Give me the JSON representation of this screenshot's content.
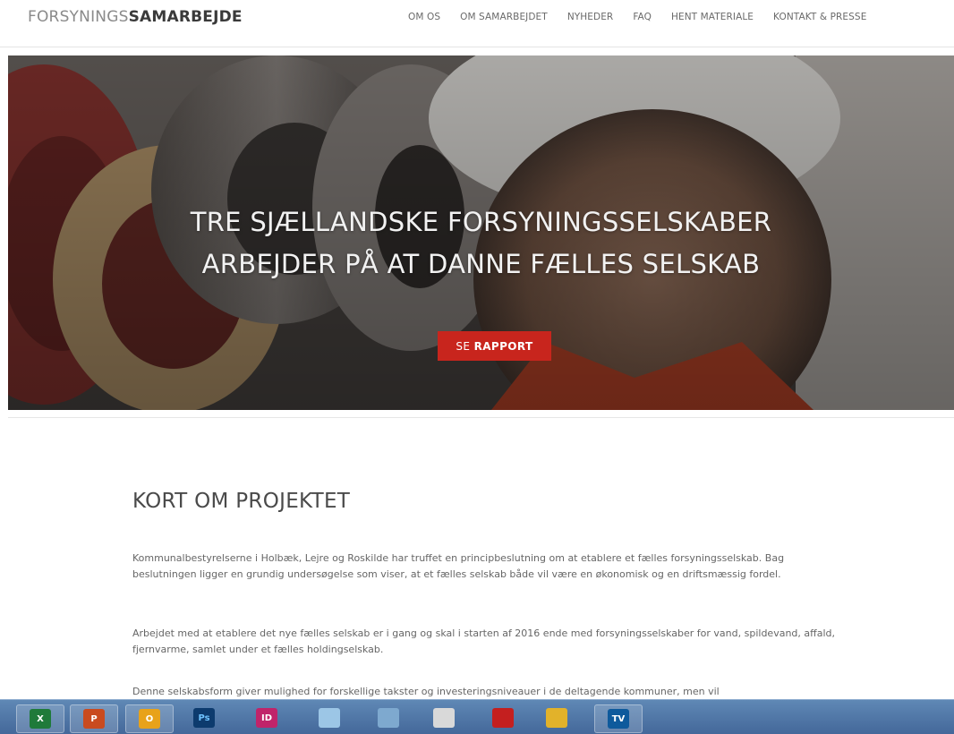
{
  "header": {
    "logo_light": "FORSYNINGS",
    "logo_bold": "SAMARBEJDE",
    "nav": [
      {
        "label": "OM OS"
      },
      {
        "label": "OM SAMARBEJDET"
      },
      {
        "label": "NYHEDER"
      },
      {
        "label": "FAQ"
      },
      {
        "label": "HENT MATERIALE"
      },
      {
        "label": "KONTAKT & PRESSE"
      }
    ]
  },
  "hero": {
    "line1": "TRE SJÆLLANDSKE FORSYNINGSSELSKABER",
    "line2": "ARBEJDER PÅ AT DANNE FÆLLES SELSKAB",
    "button_light": "SE ",
    "button_bold": "RAPPORT",
    "button_color": "#c8251d"
  },
  "content": {
    "title": "KORT OM PROJEKTET",
    "paragraphs": [
      "Kommunalbestyrelserne i Holbæk, Lejre og Roskilde har truffet en principbeslutning om at etablere et fælles forsyningsselskab. Bag beslutningen ligger en grundig undersøgelse som viser, at et fælles selskab både vil være en økonomisk og en driftsmæssig fordel.",
      "Arbejdet med at etablere det nye fælles selskab er i gang og skal i starten af 2016 ende med forsyningsselskaber for vand, spildevand, affald, fjernvarme, samlet under et fælles holdingselskab.",
      "Denne selskabsform giver mulighed for forskellige takster og investeringsniveauer i de deltagende kommuner, men vil"
    ]
  },
  "taskbar": {
    "items": [
      {
        "icon": "excel-icon",
        "label": "X",
        "color": "#1f7a3a"
      },
      {
        "icon": "powerpoint-icon",
        "label": "P",
        "color": "#c94b1f"
      },
      {
        "icon": "outlook-icon",
        "label": "O",
        "color": "#e8a21a"
      },
      {
        "icon": "photoshop-icon",
        "label": "Ps",
        "color": "#0d3b6e"
      },
      {
        "icon": "indesign-icon",
        "label": "ID",
        "color": "#c0246a"
      },
      {
        "icon": "notepad-icon",
        "label": "",
        "color": "#9cc6e6"
      },
      {
        "icon": "network-icon",
        "label": "",
        "color": "#7ea9cf"
      },
      {
        "icon": "paint-icon",
        "label": "",
        "color": "#d9d9d9"
      },
      {
        "icon": "acrobat-icon",
        "label": "",
        "color": "#c41f1f"
      },
      {
        "icon": "chart-app-icon",
        "label": "",
        "color": "#e2b22a"
      },
      {
        "icon": "teamviewer-icon",
        "label": "TV",
        "color": "#0e5a9c"
      }
    ]
  }
}
